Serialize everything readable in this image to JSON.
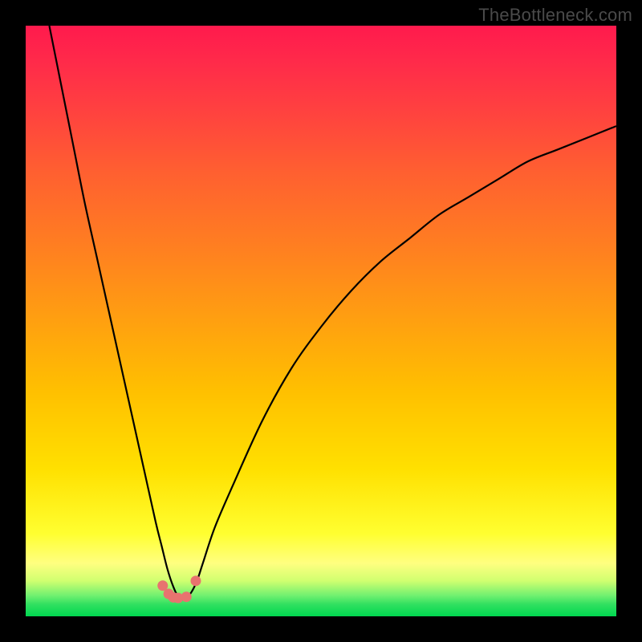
{
  "watermark": "TheBottleneck.com",
  "chart_data": {
    "type": "line",
    "title": "",
    "xlabel": "",
    "ylabel": "",
    "xlim": [
      0,
      100
    ],
    "ylim": [
      0,
      100
    ],
    "series": [
      {
        "name": "bottleneck-curve",
        "x": [
          4,
          6,
          8,
          10,
          12,
          14,
          16,
          18,
          20,
          22,
          23,
          24,
          25,
          26,
          27,
          28,
          29,
          30,
          32,
          35,
          40,
          45,
          50,
          55,
          60,
          65,
          70,
          75,
          80,
          85,
          90,
          95,
          100
        ],
        "y": [
          100,
          90,
          80,
          70,
          61,
          52,
          43,
          34,
          25,
          16,
          12,
          8,
          5,
          3,
          3,
          4,
          6,
          9,
          15,
          22,
          33,
          42,
          49,
          55,
          60,
          64,
          68,
          71,
          74,
          77,
          79,
          81,
          83
        ]
      }
    ],
    "markers": {
      "name": "trough-points",
      "x": [
        23.2,
        24.2,
        25.0,
        25.8,
        27.2,
        28.8
      ],
      "y": [
        5.2,
        3.8,
        3.2,
        3.1,
        3.3,
        6.0
      ]
    },
    "gradient_stops": [
      {
        "pos": 0.0,
        "color": "#ff1a4d"
      },
      {
        "pos": 0.5,
        "color": "#ffa010"
      },
      {
        "pos": 0.86,
        "color": "#ffff30"
      },
      {
        "pos": 1.0,
        "color": "#00d850"
      }
    ]
  }
}
